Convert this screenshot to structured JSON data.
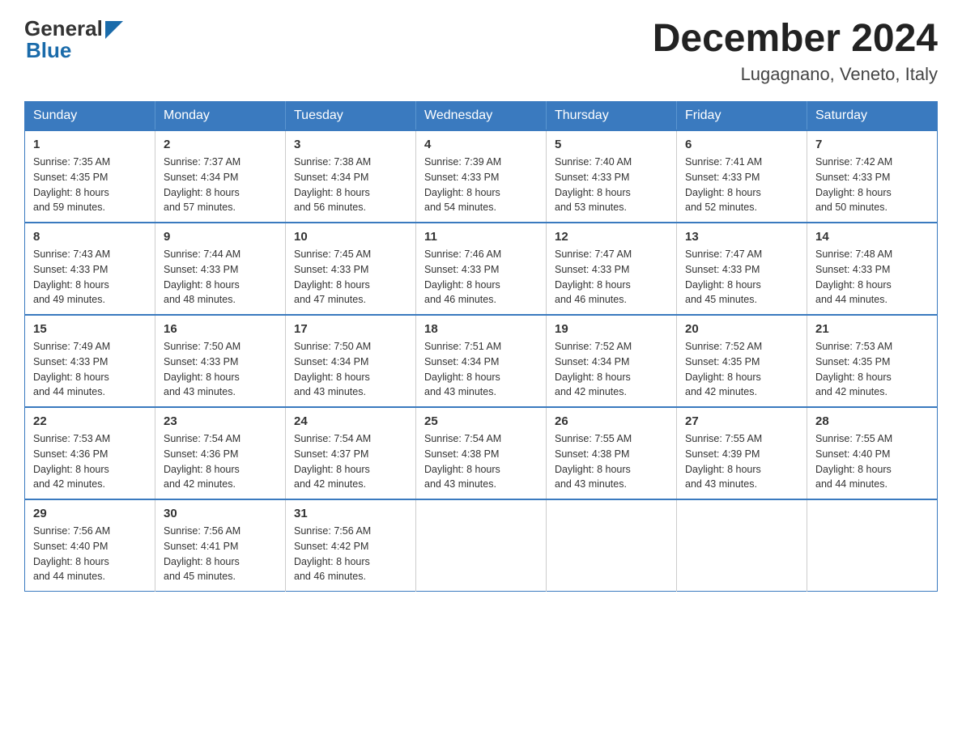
{
  "header": {
    "logo_general": "General",
    "logo_blue": "Blue",
    "month_title": "December 2024",
    "location": "Lugagnano, Veneto, Italy"
  },
  "calendar": {
    "days_of_week": [
      "Sunday",
      "Monday",
      "Tuesday",
      "Wednesday",
      "Thursday",
      "Friday",
      "Saturday"
    ],
    "weeks": [
      [
        {
          "day": "1",
          "sunrise": "7:35 AM",
          "sunset": "4:35 PM",
          "daylight": "8 hours and 59 minutes."
        },
        {
          "day": "2",
          "sunrise": "7:37 AM",
          "sunset": "4:34 PM",
          "daylight": "8 hours and 57 minutes."
        },
        {
          "day": "3",
          "sunrise": "7:38 AM",
          "sunset": "4:34 PM",
          "daylight": "8 hours and 56 minutes."
        },
        {
          "day": "4",
          "sunrise": "7:39 AM",
          "sunset": "4:33 PM",
          "daylight": "8 hours and 54 minutes."
        },
        {
          "day": "5",
          "sunrise": "7:40 AM",
          "sunset": "4:33 PM",
          "daylight": "8 hours and 53 minutes."
        },
        {
          "day": "6",
          "sunrise": "7:41 AM",
          "sunset": "4:33 PM",
          "daylight": "8 hours and 52 minutes."
        },
        {
          "day": "7",
          "sunrise": "7:42 AM",
          "sunset": "4:33 PM",
          "daylight": "8 hours and 50 minutes."
        }
      ],
      [
        {
          "day": "8",
          "sunrise": "7:43 AM",
          "sunset": "4:33 PM",
          "daylight": "8 hours and 49 minutes."
        },
        {
          "day": "9",
          "sunrise": "7:44 AM",
          "sunset": "4:33 PM",
          "daylight": "8 hours and 48 minutes."
        },
        {
          "day": "10",
          "sunrise": "7:45 AM",
          "sunset": "4:33 PM",
          "daylight": "8 hours and 47 minutes."
        },
        {
          "day": "11",
          "sunrise": "7:46 AM",
          "sunset": "4:33 PM",
          "daylight": "8 hours and 46 minutes."
        },
        {
          "day": "12",
          "sunrise": "7:47 AM",
          "sunset": "4:33 PM",
          "daylight": "8 hours and 46 minutes."
        },
        {
          "day": "13",
          "sunrise": "7:47 AM",
          "sunset": "4:33 PM",
          "daylight": "8 hours and 45 minutes."
        },
        {
          "day": "14",
          "sunrise": "7:48 AM",
          "sunset": "4:33 PM",
          "daylight": "8 hours and 44 minutes."
        }
      ],
      [
        {
          "day": "15",
          "sunrise": "7:49 AM",
          "sunset": "4:33 PM",
          "daylight": "8 hours and 44 minutes."
        },
        {
          "day": "16",
          "sunrise": "7:50 AM",
          "sunset": "4:33 PM",
          "daylight": "8 hours and 43 minutes."
        },
        {
          "day": "17",
          "sunrise": "7:50 AM",
          "sunset": "4:34 PM",
          "daylight": "8 hours and 43 minutes."
        },
        {
          "day": "18",
          "sunrise": "7:51 AM",
          "sunset": "4:34 PM",
          "daylight": "8 hours and 43 minutes."
        },
        {
          "day": "19",
          "sunrise": "7:52 AM",
          "sunset": "4:34 PM",
          "daylight": "8 hours and 42 minutes."
        },
        {
          "day": "20",
          "sunrise": "7:52 AM",
          "sunset": "4:35 PM",
          "daylight": "8 hours and 42 minutes."
        },
        {
          "day": "21",
          "sunrise": "7:53 AM",
          "sunset": "4:35 PM",
          "daylight": "8 hours and 42 minutes."
        }
      ],
      [
        {
          "day": "22",
          "sunrise": "7:53 AM",
          "sunset": "4:36 PM",
          "daylight": "8 hours and 42 minutes."
        },
        {
          "day": "23",
          "sunrise": "7:54 AM",
          "sunset": "4:36 PM",
          "daylight": "8 hours and 42 minutes."
        },
        {
          "day": "24",
          "sunrise": "7:54 AM",
          "sunset": "4:37 PM",
          "daylight": "8 hours and 42 minutes."
        },
        {
          "day": "25",
          "sunrise": "7:54 AM",
          "sunset": "4:38 PM",
          "daylight": "8 hours and 43 minutes."
        },
        {
          "day": "26",
          "sunrise": "7:55 AM",
          "sunset": "4:38 PM",
          "daylight": "8 hours and 43 minutes."
        },
        {
          "day": "27",
          "sunrise": "7:55 AM",
          "sunset": "4:39 PM",
          "daylight": "8 hours and 43 minutes."
        },
        {
          "day": "28",
          "sunrise": "7:55 AM",
          "sunset": "4:40 PM",
          "daylight": "8 hours and 44 minutes."
        }
      ],
      [
        {
          "day": "29",
          "sunrise": "7:56 AM",
          "sunset": "4:40 PM",
          "daylight": "8 hours and 44 minutes."
        },
        {
          "day": "30",
          "sunrise": "7:56 AM",
          "sunset": "4:41 PM",
          "daylight": "8 hours and 45 minutes."
        },
        {
          "day": "31",
          "sunrise": "7:56 AM",
          "sunset": "4:42 PM",
          "daylight": "8 hours and 46 minutes."
        },
        null,
        null,
        null,
        null
      ]
    ],
    "labels": {
      "sunrise": "Sunrise: ",
      "sunset": "Sunset: ",
      "daylight": "Daylight: "
    }
  }
}
